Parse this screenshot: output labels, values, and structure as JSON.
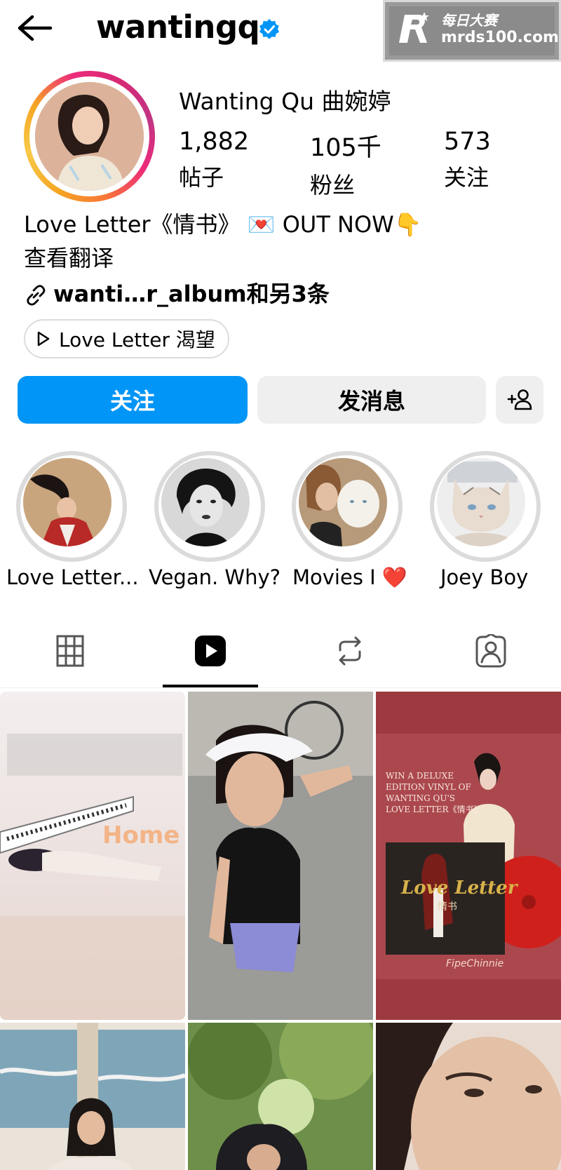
{
  "header": {
    "username": "wantingq",
    "watermark_line1": "每日大赛",
    "watermark_line2": "mrds100.com"
  },
  "profile": {
    "full_name": "Wanting Qu 曲婉婷",
    "stats": [
      {
        "value": "1,882",
        "label": "帖子"
      },
      {
        "value": "105千",
        "label": "粉丝"
      },
      {
        "value": "573",
        "label": "关注"
      }
    ],
    "bio": "Love Letter《情书》 💌 OUT NOW👇",
    "translate": "查看翻译",
    "link": "wanti…r_album和另3条",
    "music_label": "Love Letter 渴望"
  },
  "actions": {
    "follow_label": "关注",
    "message_label": "发消息"
  },
  "highlights": [
    {
      "label": "Love Letter..."
    },
    {
      "label": "Vegan. Why?"
    },
    {
      "label": "Movies I ❤️"
    },
    {
      "label": "Joey Boy"
    }
  ],
  "tabs": [
    "grid-icon",
    "reels-icon",
    "reposts-icon",
    "tagged-icon"
  ],
  "grid": {
    "tile1_text": "Home",
    "tile3_lines": [
      "WIN A DELUXE",
      "EDITION VINYL OF",
      "WANTING QU'S",
      "LOVE LETTER《情书》"
    ],
    "tile3_album": "Love Letter",
    "tile3_album_cn": "情书",
    "tile3_sign": "FipeChinnie"
  },
  "colors": {
    "accent": "#0095f6",
    "verified": "#0095f6",
    "button_gray": "#efefef"
  }
}
